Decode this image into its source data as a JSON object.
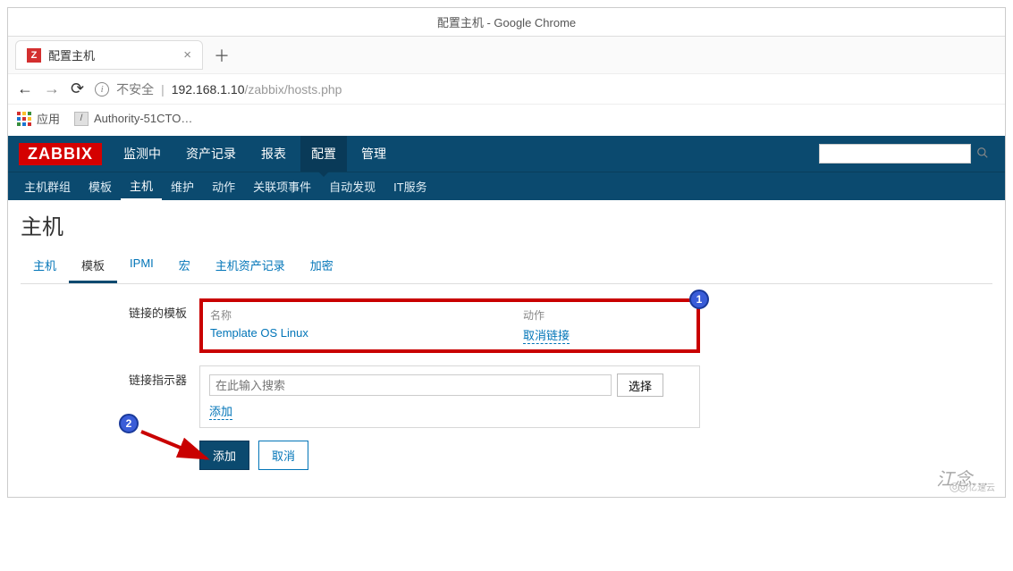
{
  "window": {
    "title": "配置主机 - Google Chrome"
  },
  "browser": {
    "tab": {
      "favicon": "Z",
      "title": "配置主机"
    },
    "nav": {
      "insecure_label": "不安全",
      "url_host": "192.168.1.10",
      "url_path": "/zabbix/hosts.php"
    },
    "bookmarks": {
      "apps_label": "应用",
      "item1": "Authority-51CTO…"
    }
  },
  "zabbix": {
    "logo": "ZABBIX",
    "main_nav": {
      "monitoring": "监测中",
      "inventory": "资产记录",
      "reports": "报表",
      "config": "配置",
      "admin": "管理"
    },
    "sub_nav": {
      "host_groups": "主机群组",
      "templates": "模板",
      "hosts": "主机",
      "maintenance": "维护",
      "actions": "动作",
      "correlation": "关联项事件",
      "discovery": "自动发现",
      "it_services": "IT服务"
    },
    "page_title": "主机",
    "tabs": {
      "host": "主机",
      "templates": "模板",
      "ipmi": "IPMI",
      "macros": "宏",
      "inventory": "主机资产记录",
      "encryption": "加密"
    },
    "linked_templates": {
      "label": "链接的模板",
      "header_name": "名称",
      "header_action": "动作",
      "row_name": "Template OS Linux",
      "row_action": "取消链接"
    },
    "link_indicator": {
      "label": "链接指示器",
      "placeholder": "在此输入搜索",
      "select_btn": "选择",
      "add_link": "添加"
    },
    "buttons": {
      "add": "添加",
      "cancel": "取消"
    }
  },
  "annotations": {
    "one": "1",
    "two": "2"
  },
  "watermark": {
    "text": "江念…",
    "brand": "亿速云"
  }
}
